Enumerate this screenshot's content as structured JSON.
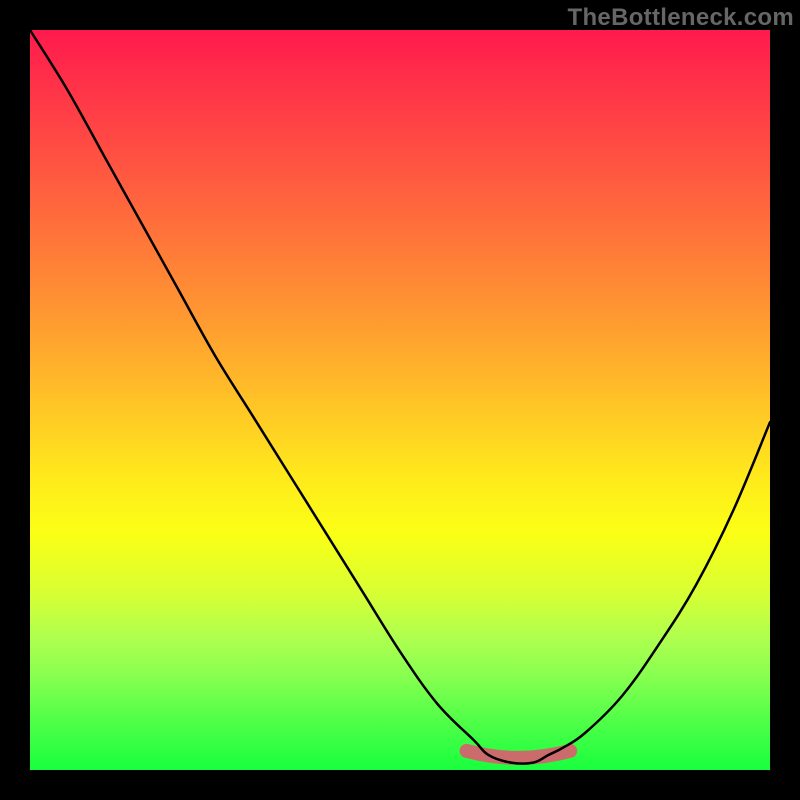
{
  "watermark": "TheBottleneck.com",
  "colors": {
    "background": "#000000",
    "curve": "#000000",
    "highlight": "#cc6b6b",
    "gradient_top": "#ff1a4d",
    "gradient_bottom": "#18ff3e"
  },
  "chart_data": {
    "type": "line",
    "title": "",
    "xlabel": "",
    "ylabel": "",
    "xlim": [
      0,
      100
    ],
    "ylim": [
      0,
      100
    ],
    "grid": false,
    "series": [
      {
        "name": "bottleneck-curve",
        "x": [
          0,
          5,
          10,
          15,
          20,
          25,
          30,
          35,
          40,
          45,
          50,
          55,
          60,
          62,
          65,
          68,
          70,
          72,
          75,
          80,
          85,
          90,
          95,
          100
        ],
        "y": [
          100,
          92,
          83,
          74,
          65,
          56,
          48,
          40,
          32,
          24,
          16,
          9,
          4,
          2,
          1,
          1,
          2,
          3,
          5,
          10,
          17,
          25,
          35,
          47
        ]
      }
    ],
    "highlight_range": {
      "x_center": 66,
      "x_start": 59,
      "x_end": 73,
      "y": 1.5,
      "label": "optimal-zone"
    },
    "background_gradient": {
      "type": "vertical",
      "top_color_meaning": "high-bottleneck",
      "bottom_color_meaning": "low-bottleneck"
    }
  }
}
